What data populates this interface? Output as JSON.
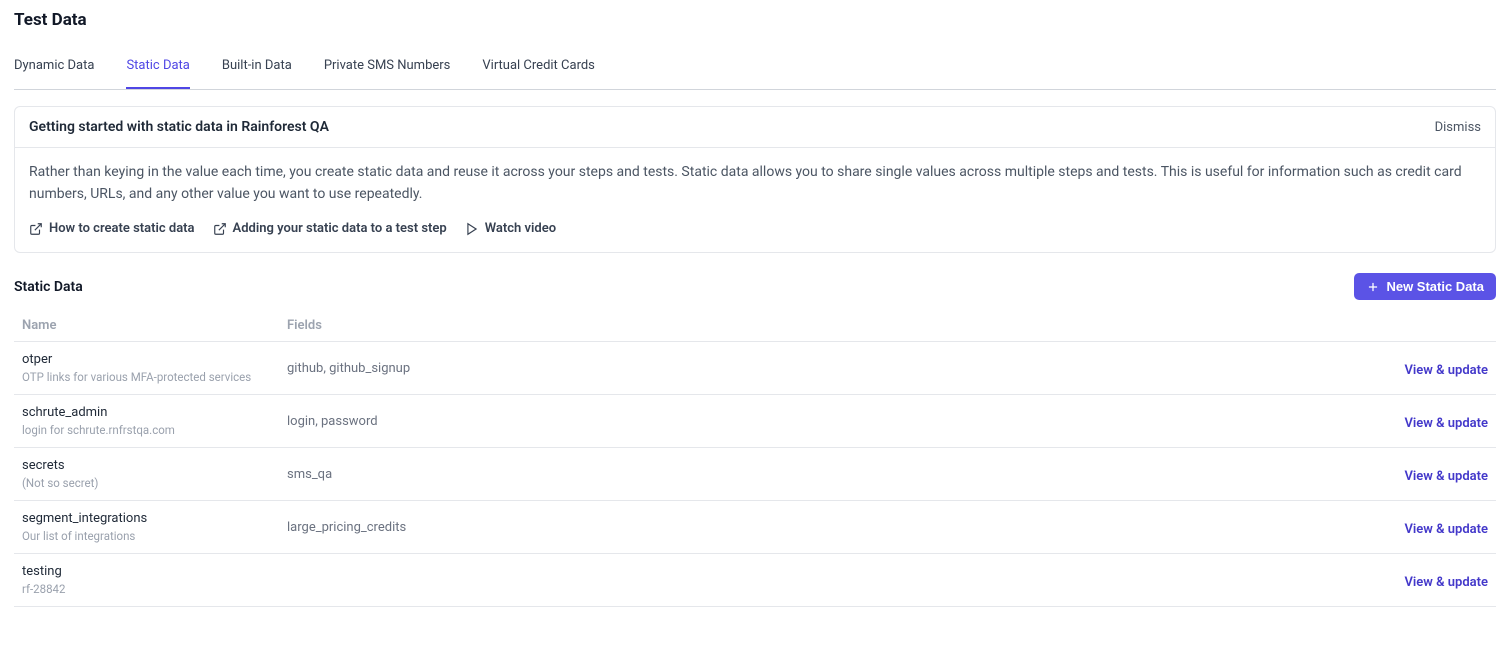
{
  "page_title": "Test Data",
  "tabs": [
    {
      "label": "Dynamic Data"
    },
    {
      "label": "Static Data"
    },
    {
      "label": "Built-in Data"
    },
    {
      "label": "Private SMS Numbers"
    },
    {
      "label": "Virtual Credit Cards"
    }
  ],
  "active_tab_index": 1,
  "info": {
    "title": "Getting started with static data in Rainforest QA",
    "dismiss_label": "Dismiss",
    "description": "Rather than keying in the value each time, you create static data and reuse it across your steps and tests. Static data allows you to share single values across multiple steps and tests. This is useful for information such as credit card numbers, URLs, and any other value you want to use repeatedly.",
    "links": {
      "howto": "How to create static data",
      "adding": "Adding your static data to a test step",
      "video": "Watch video"
    }
  },
  "section": {
    "title": "Static Data",
    "new_btn_label": "New Static Data",
    "columns": {
      "name": "Name",
      "fields": "Fields"
    },
    "action_label": "View & update",
    "rows": [
      {
        "name": "otper",
        "desc": "OTP links for various MFA-protected services",
        "fields": "github, github_signup"
      },
      {
        "name": "schrute_admin",
        "desc": "login for schrute.rnfrstqa.com",
        "fields": "login, password"
      },
      {
        "name": "secrets",
        "desc": "(Not so secret)",
        "fields": "sms_qa"
      },
      {
        "name": "segment_integrations",
        "desc": "Our list of integrations",
        "fields": "large_pricing_credits"
      },
      {
        "name": "testing",
        "desc": "rf-28842",
        "fields": ""
      }
    ]
  }
}
